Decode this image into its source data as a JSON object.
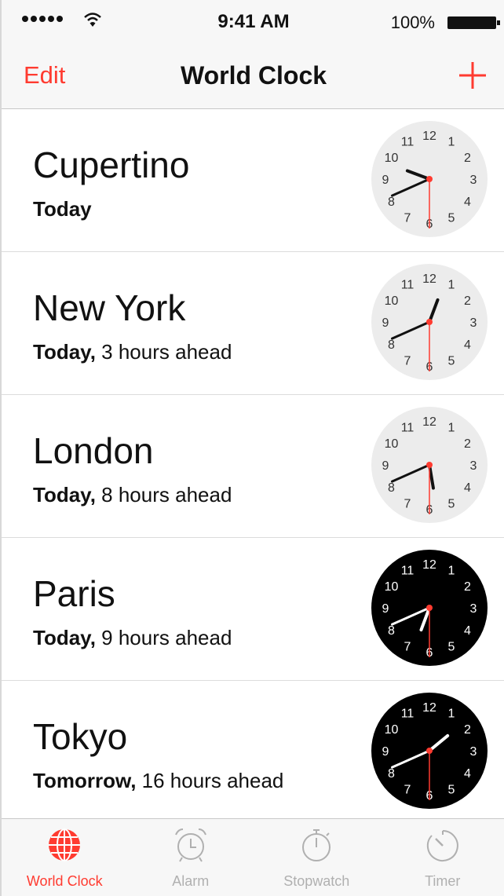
{
  "status_bar": {
    "time": "9:41 AM",
    "battery": "100%"
  },
  "nav": {
    "edit": "Edit",
    "title": "World Clock"
  },
  "clocks": [
    {
      "city": "Cupertino",
      "day": "Today",
      "offset": "",
      "hour": 9,
      "minute": 41,
      "theme": "light"
    },
    {
      "city": "New York",
      "day": "Today,",
      "offset": " 3 hours ahead",
      "hour": 12,
      "minute": 41,
      "theme": "light"
    },
    {
      "city": "London",
      "day": "Today,",
      "offset": " 8 hours ahead",
      "hour": 17,
      "minute": 41,
      "theme": "light"
    },
    {
      "city": "Paris",
      "day": "Today,",
      "offset": " 9 hours ahead",
      "hour": 18,
      "minute": 41,
      "theme": "dark"
    },
    {
      "city": "Tokyo",
      "day": "Tomorrow,",
      "offset": " 16 hours ahead",
      "hour": 1,
      "minute": 41,
      "theme": "dark"
    }
  ],
  "clock_numerals": [
    "12",
    "1",
    "2",
    "3",
    "4",
    "5",
    "6",
    "7",
    "8",
    "9",
    "10",
    "11"
  ],
  "tabs": [
    {
      "label": "World Clock",
      "icon": "globe-icon",
      "active": true
    },
    {
      "label": "Alarm",
      "icon": "alarm-clock-icon",
      "active": false
    },
    {
      "label": "Stopwatch",
      "icon": "stopwatch-icon",
      "active": false
    },
    {
      "label": "Timer",
      "icon": "timer-icon",
      "active": false
    }
  ],
  "colors": {
    "accent": "#ff3b30",
    "light_face": "#ececec",
    "dark_face": "#000000"
  }
}
